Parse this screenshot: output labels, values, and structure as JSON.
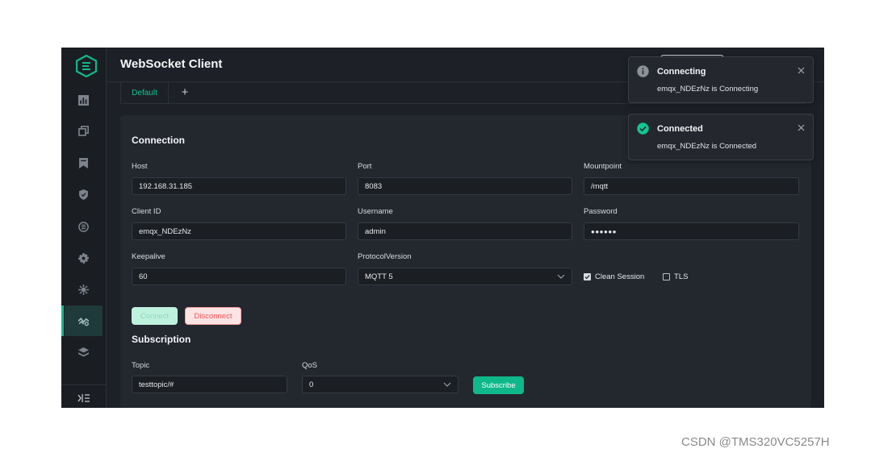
{
  "header": {
    "title": "WebSocket Client"
  },
  "tabs": [
    {
      "label": "Default"
    }
  ],
  "tab_add_label": "+",
  "connection": {
    "title": "Connection",
    "host": {
      "label": "Host",
      "value": "192.168.31.185"
    },
    "port": {
      "label": "Port",
      "value": "8083"
    },
    "mountpoint": {
      "label": "Mountpoint",
      "value": "/mqtt"
    },
    "client_id": {
      "label": "Client ID",
      "value": "emqx_NDEzNz"
    },
    "username": {
      "label": "Username",
      "value": "admin"
    },
    "password": {
      "label": "Password",
      "value": "●●●●●●"
    },
    "keepalive": {
      "label": "Keepalive",
      "value": "60"
    },
    "protocol_version": {
      "label": "ProtocolVersion",
      "value": "MQTT 5"
    },
    "clean_session": {
      "label": "Clean Session",
      "checked": true
    },
    "tls": {
      "label": "TLS",
      "checked": false
    },
    "connect_label": "Connect",
    "disconnect_label": "Disconnect"
  },
  "subscription": {
    "title": "Subscription",
    "topic": {
      "label": "Topic",
      "value": "testtopic/#"
    },
    "qos": {
      "label": "QoS",
      "value": "0"
    },
    "subscribe_label": "Subscribe"
  },
  "notifications": [
    {
      "title": "Connecting",
      "message": "emqx_NDEzNz is Connecting",
      "type": "info"
    },
    {
      "title": "Connected",
      "message": "emqx_NDEzNz is Connected",
      "type": "success"
    }
  ],
  "sidebar": {
    "items": [
      {
        "icon": "dashboard-icon"
      },
      {
        "icon": "clients-icon"
      },
      {
        "icon": "subscriptions-icon"
      },
      {
        "icon": "shield-icon"
      },
      {
        "icon": "rules-icon"
      },
      {
        "icon": "settings-icon"
      },
      {
        "icon": "plugins-icon"
      },
      {
        "icon": "websocket-icon",
        "active": true
      },
      {
        "icon": "layers-icon"
      }
    ]
  },
  "colors": {
    "accent": "#0fb98c",
    "background": "#1d2026",
    "card": "#23272e",
    "danger": "#f05454"
  },
  "watermark": "CSDN @TMS320VC5257H"
}
